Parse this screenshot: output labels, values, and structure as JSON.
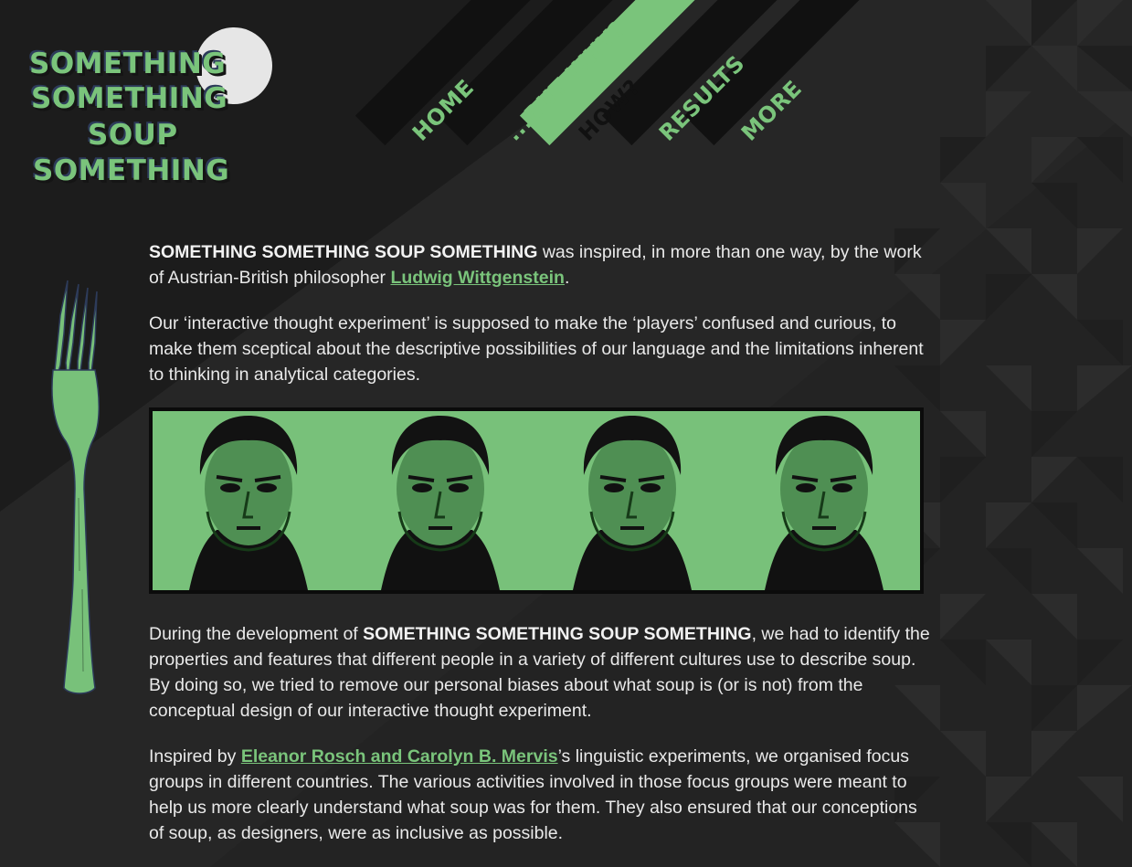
{
  "site": {
    "logo_lines": [
      "SOMETHING",
      "SOMETHING",
      "SOUP",
      "SOMETHING"
    ]
  },
  "nav": {
    "items": [
      {
        "label": "HOME",
        "active": false
      },
      {
        "label": "...BUT WHY?",
        "active": false
      },
      {
        "label": "HOW?",
        "active": true
      },
      {
        "label": "RESULTS",
        "active": false
      },
      {
        "label": "MORE",
        "active": false
      }
    ]
  },
  "content": {
    "p1_bold": "SOMETHING SOMETHING SOUP SOMETHING",
    "p1_text": " was inspired, in more than one way, by the work of Austrian-British philosopher ",
    "p1_link": "Ludwig Wittgenstein",
    "p1_end": ".",
    "p2": "Our ‘interactive thought experiment’ is supposed to make the ‘players’ confused and curious, to make them sceptical about the descriptive possibilities of our language and the limitations inherent to thinking in analytical categories.",
    "p3_start": "During the development of ",
    "p3_bold": "SOMETHING SOMETHING SOUP SOMETHING",
    "p3_text": ", we had to identify the properties and features that different people in a variety of different cultures use to describe soup. By doing so, we tried to remove our personal biases about what soup is (or is not) from the conceptual design of our interactive thought experiment.",
    "p4_start": "Inspired by ",
    "p4_link": "Eleanor Rosch and Carolyn B. Mervis",
    "p4_text": "’s linguistic experiments, we organised focus groups in different countries. The various activities involved in those focus groups were meant to help us more clearly understand what soup was for them. They also ensured that our conceptions of soup, as designers, were as inclusive as possible."
  },
  "colors": {
    "accent": "#7ac47b",
    "background": "#232323",
    "nav_dark": "#111111"
  },
  "icons": {
    "fork": "fork-icon",
    "banner": "wittgenstein-portrait-banner"
  }
}
